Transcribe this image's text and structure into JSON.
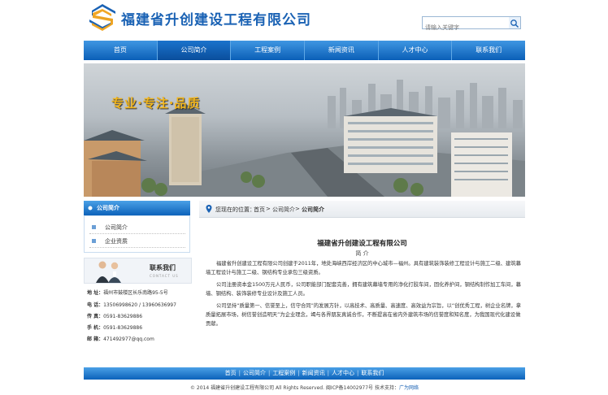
{
  "header": {
    "company_name": "福建省升创建设工程有限公司",
    "search_placeholder": "请输入关键字"
  },
  "nav": {
    "items": [
      {
        "label": "首页"
      },
      {
        "label": "公司简介"
      },
      {
        "label": "工程案例"
      },
      {
        "label": "新闻资讯"
      },
      {
        "label": "人才中心"
      },
      {
        "label": "联系我们"
      }
    ],
    "active_index": 1
  },
  "banner": {
    "slogan": "专业·专注·品质"
  },
  "sidebar": {
    "title": "公司简介",
    "items": [
      {
        "label": "公司简介"
      },
      {
        "label": "企业资质"
      }
    ],
    "contact": {
      "title": "联系我们",
      "subtitle": "CONTACT US",
      "rows": [
        {
          "label": "地  址：",
          "value": "福州市鼓楼区长乐南路95-5号"
        },
        {
          "label": "电  话：",
          "value": "13506998620 / 13960636997"
        },
        {
          "label": "传  真：",
          "value": "0591-83629886"
        },
        {
          "label": "手  机：",
          "value": "0591-83629886"
        },
        {
          "label": "邮  箱：",
          "value": "471492977@qq.com"
        }
      ]
    }
  },
  "breadcrumb": {
    "prefix": "您现在的位置：",
    "home": "首页",
    "sep": ">",
    "parent": "公司简介",
    "current": "公司简介"
  },
  "article": {
    "title": "福建省升创建设工程有限公司",
    "subtitle": "简 介",
    "paragraphs": [
      "福建省升创建设工程有限公司创建于2011年，地处海峡西岸经济区的中心城市—福州。具有建筑装饰装修工程设计与施工二级、建筑幕墙工程设计与施工二级、钢结构专业承包三级资质。",
      "公司注册资本金1500万元人民币，公司职能部门配套完善，拥有建筑幕墙专用的净化打胶车间，固化养护间，钢结构制作加工车间，幕墙、钢结构、装饰装修专业设计及施工人员。",
      "公司坚持“质量第一、信誉至上，信守合同”的发展方针，以高技术、高质量、高速度、高效益为宗旨，以“创优秀工程，树企业名牌，拿质量拓展市场，树信誉创造明天”为企业理念，竭与各界朋友真诚合作，不断提高在省内外建筑市场的信誉度和知名度，为我国现代化建设做贡献。"
    ]
  },
  "footer": {
    "links": [
      {
        "label": "首页"
      },
      {
        "label": "公司简介"
      },
      {
        "label": "工程案例"
      },
      {
        "label": "新闻资讯"
      },
      {
        "label": "人才中心"
      },
      {
        "label": "联系我们"
      }
    ],
    "copyright": "© 2014 福建省升创建设工程有限公司 All Rights Reserved. 闽ICP备14002977号   技术支持：",
    "support_link": "广为网络"
  },
  "colors": {
    "brand_blue": "#1a62b4",
    "nav_blue": "#0b5fb7",
    "slogan_gold": "#f1b51c"
  },
  "icons": {
    "logo": "s-logo",
    "search": "search-icon",
    "sidebar_head": "bullet-icon",
    "breadcrumb": "location-pin-icon"
  }
}
